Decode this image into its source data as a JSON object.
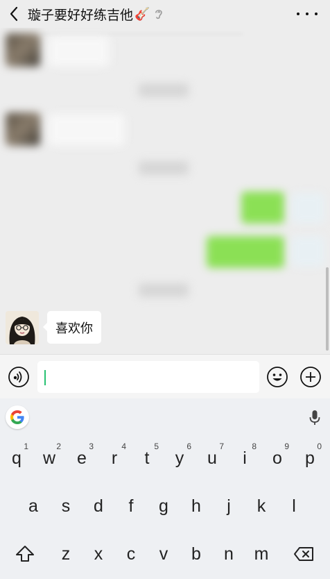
{
  "header": {
    "title": "璇子要好好练吉他",
    "title_emoji": "🎸"
  },
  "chat": {
    "last_message": {
      "text": "喜欢你",
      "sender": "other"
    }
  },
  "input": {
    "value": "",
    "placeholder": ""
  },
  "keyboard": {
    "row1": [
      {
        "letter": "q",
        "num": "1"
      },
      {
        "letter": "w",
        "num": "2"
      },
      {
        "letter": "e",
        "num": "3"
      },
      {
        "letter": "r",
        "num": "4"
      },
      {
        "letter": "t",
        "num": "5"
      },
      {
        "letter": "y",
        "num": "6"
      },
      {
        "letter": "u",
        "num": "7"
      },
      {
        "letter": "i",
        "num": "8"
      },
      {
        "letter": "o",
        "num": "9"
      },
      {
        "letter": "p",
        "num": "0"
      }
    ],
    "row2": [
      "a",
      "s",
      "d",
      "f",
      "g",
      "h",
      "j",
      "k",
      "l"
    ],
    "row3": [
      "z",
      "x",
      "c",
      "v",
      "b",
      "n",
      "m"
    ]
  },
  "colors": {
    "accent_green": "#95ec69",
    "caret_green": "#27c172",
    "background": "#ededed"
  },
  "icons": [
    "back-arrow-icon",
    "ear-icon",
    "more-icon",
    "voice-icon",
    "emoji-icon",
    "plus-icon",
    "google-icon",
    "mic-icon",
    "shift-icon",
    "backspace-icon"
  ]
}
